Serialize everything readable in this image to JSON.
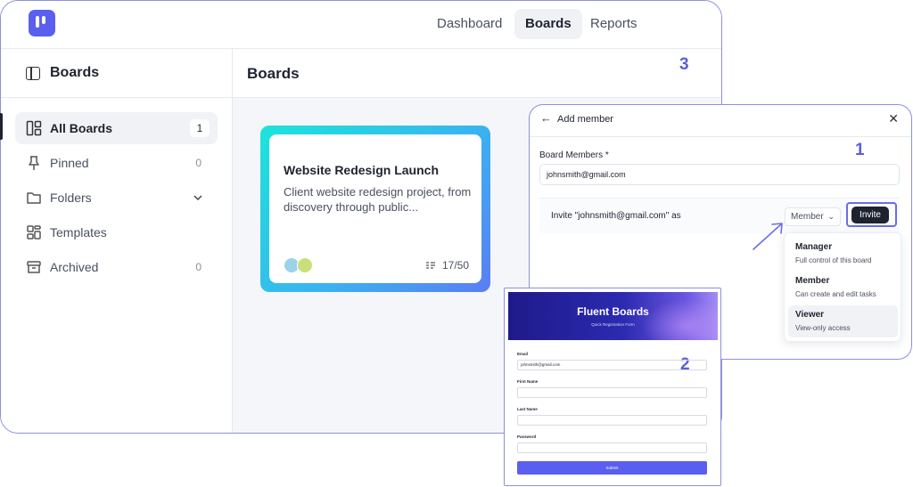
{
  "topnav": {
    "items": [
      {
        "label": "Dashboard",
        "active": false
      },
      {
        "label": "Boards",
        "active": true
      },
      {
        "label": "Reports",
        "active": false
      }
    ]
  },
  "sidebar": {
    "title": "Boards",
    "items": [
      {
        "label": "All Boards",
        "count": "1",
        "icon": "grid-icon",
        "active": true
      },
      {
        "label": "Pinned",
        "count": "0",
        "icon": "pin-icon"
      },
      {
        "label": "Folders",
        "icon": "folder-icon",
        "chevron": "chevron-down-icon"
      },
      {
        "label": "Templates",
        "icon": "templates-icon"
      },
      {
        "label": "Archived",
        "count": "0",
        "icon": "archive-icon"
      }
    ]
  },
  "main": {
    "title": "Boards",
    "board_card": {
      "title": "Website Redesign Launch",
      "description": "Client website redesign project, from discovery through public...",
      "task_count": "17/50"
    }
  },
  "callouts": {
    "one": "1",
    "two": "2",
    "three": "3"
  },
  "add_member": {
    "title": "Add member",
    "field_label": "Board Members *",
    "email_value": "johnsmith@gmail.com",
    "invite_text": "Invite \"johnsmith@gmail.com\" as",
    "role_selected": "Member",
    "invite_button": "Invite",
    "roles": [
      {
        "name": "Manager",
        "desc": "Full control of this board"
      },
      {
        "name": "Member",
        "desc": "Can create and edit tasks"
      },
      {
        "name": "Viewer",
        "desc": "View-only access"
      }
    ]
  },
  "form": {
    "title": "Fluent Boards",
    "subtitle": "Quick Registration Form",
    "fields": [
      {
        "label": "Email",
        "value": "johnsmith@gmail.com"
      },
      {
        "label": "First Name",
        "value": ""
      },
      {
        "label": "Last Name",
        "value": ""
      },
      {
        "label": "Password",
        "value": ""
      }
    ],
    "submit": "Submit"
  },
  "colors": {
    "accent": "#5a5ff0",
    "callout": "#5b5fd8",
    "card_gradient_start": "#1de4d9",
    "card_gradient_end": "#5a7df4"
  }
}
